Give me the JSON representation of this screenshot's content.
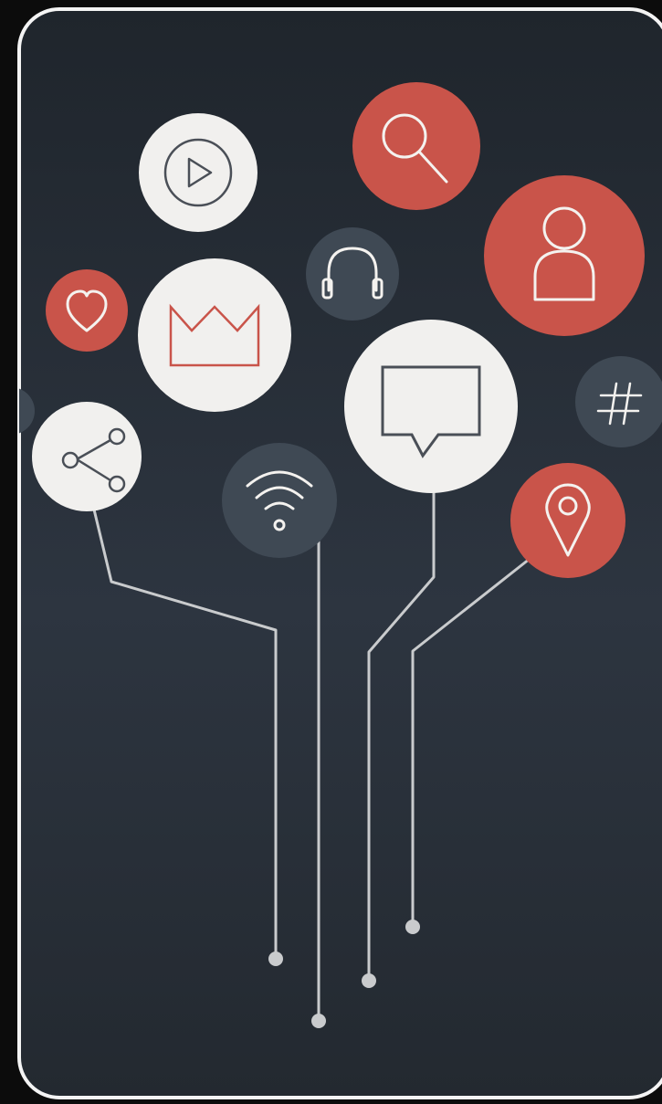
{
  "colors": {
    "page_background": "#0c0c0c",
    "frame_border": "#f4f4f4",
    "panel_top": "#1f252c",
    "panel_middle": "#2d3540",
    "panel_bottom": "#232930",
    "accent_red": "#c9544a",
    "light_circle": "#f1f0ee",
    "dark_circle": "#3f4954",
    "line": "#c9cbcd",
    "icon_dark_stroke": "#4a4f57",
    "icon_light_stroke": "#f4f2ef"
  },
  "icons": [
    {
      "name": "play-button-icon",
      "circle": "light"
    },
    {
      "name": "search-icon",
      "circle": "red"
    },
    {
      "name": "user-icon",
      "circle": "red"
    },
    {
      "name": "headphones-icon",
      "circle": "dark"
    },
    {
      "name": "heart-icon",
      "circle": "red"
    },
    {
      "name": "crown-icon",
      "circle": "light"
    },
    {
      "name": "chat-bubble-icon",
      "circle": "light"
    },
    {
      "name": "hashtag-icon",
      "circle": "dark"
    },
    {
      "name": "share-icon",
      "circle": "light"
    },
    {
      "name": "wifi-icon",
      "circle": "dark"
    },
    {
      "name": "location-pin-icon",
      "circle": "red"
    }
  ],
  "connector_count": 4
}
